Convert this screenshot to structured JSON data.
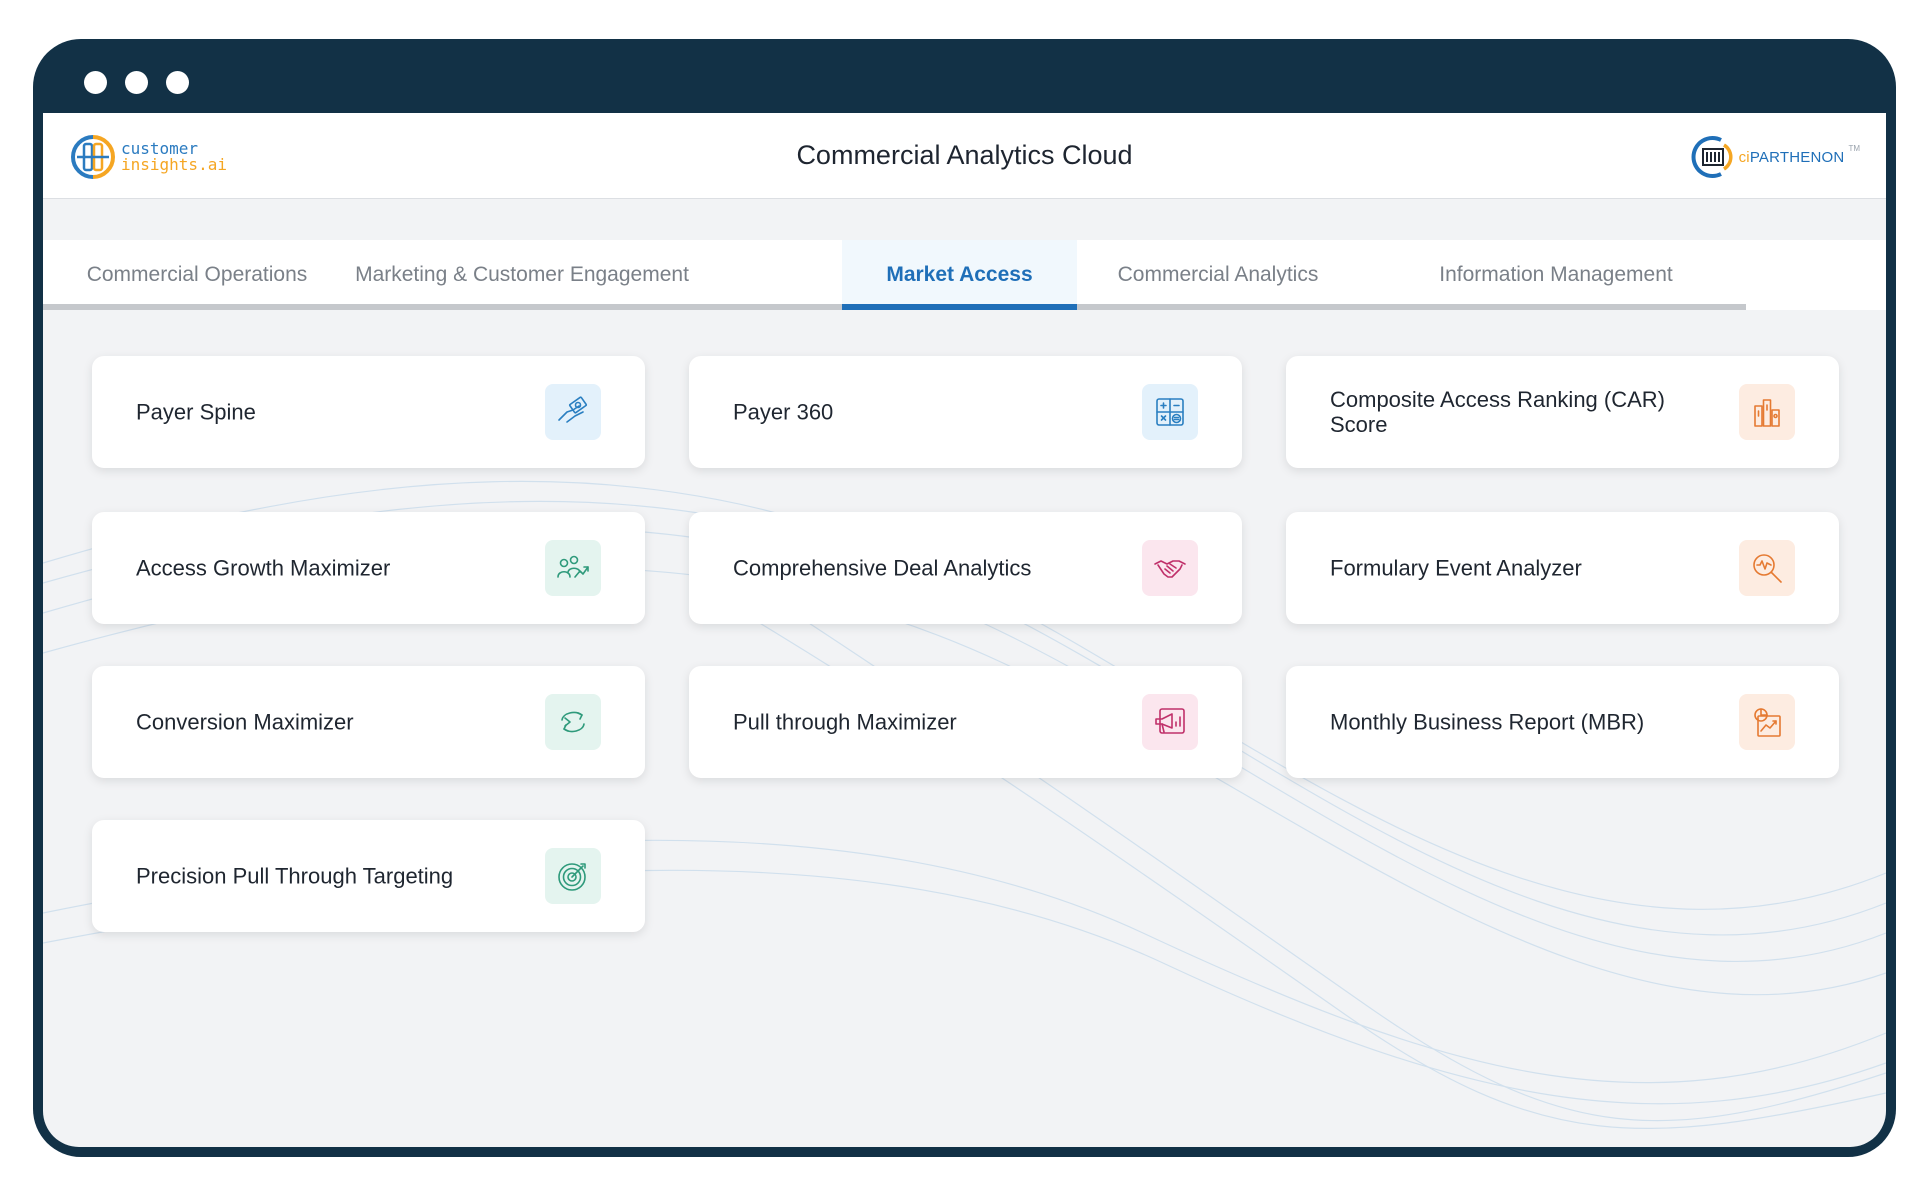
{
  "window": {
    "controls": [
      "dot",
      "dot",
      "dot"
    ]
  },
  "header": {
    "title": "Commercial Analytics Cloud",
    "logo_left": {
      "line1": "customer",
      "line2": "insights.ai"
    },
    "logo_right": {
      "prefix": "ci",
      "name": "PARTHENON",
      "tm": "TM"
    }
  },
  "tabs": [
    {
      "label": "Commercial Operations",
      "active": false
    },
    {
      "label": "Marketing & Customer Engagement",
      "active": false
    },
    {
      "label": "Market Access",
      "active": true
    },
    {
      "label": "Commercial Analytics",
      "active": false
    },
    {
      "label": "Information Management",
      "active": false
    }
  ],
  "cards": [
    {
      "label": "Payer Spine",
      "icon": "money-hand-icon",
      "color": "#2a7fc1"
    },
    {
      "label": "Payer 360",
      "icon": "calculator-icon",
      "color": "#2a7fc1"
    },
    {
      "label": "Composite Access Ranking (CAR) Score",
      "icon": "ranking-bars-icon",
      "color": "#e57a32"
    },
    {
      "label": "Access Growth Maximizer",
      "icon": "people-growth-icon",
      "color": "#2e9a7b"
    },
    {
      "label": "Comprehensive Deal Analytics",
      "icon": "handshake-icon",
      "color": "#c0306a"
    },
    {
      "label": "Formulary Event Analyzer",
      "icon": "magnifier-pulse-icon",
      "color": "#e57a32"
    },
    {
      "label": "Conversion Maximizer",
      "icon": "conversion-arrows-icon",
      "color": "#2e9a7b"
    },
    {
      "label": "Pull through Maximizer",
      "icon": "megaphone-chart-icon",
      "color": "#c0306a"
    },
    {
      "label": "Monthly Business Report (MBR)",
      "icon": "report-chart-icon",
      "color": "#e57a32"
    },
    {
      "label": "Precision Pull Through Targeting",
      "icon": "target-icon",
      "color": "#2e9a7b"
    }
  ]
}
